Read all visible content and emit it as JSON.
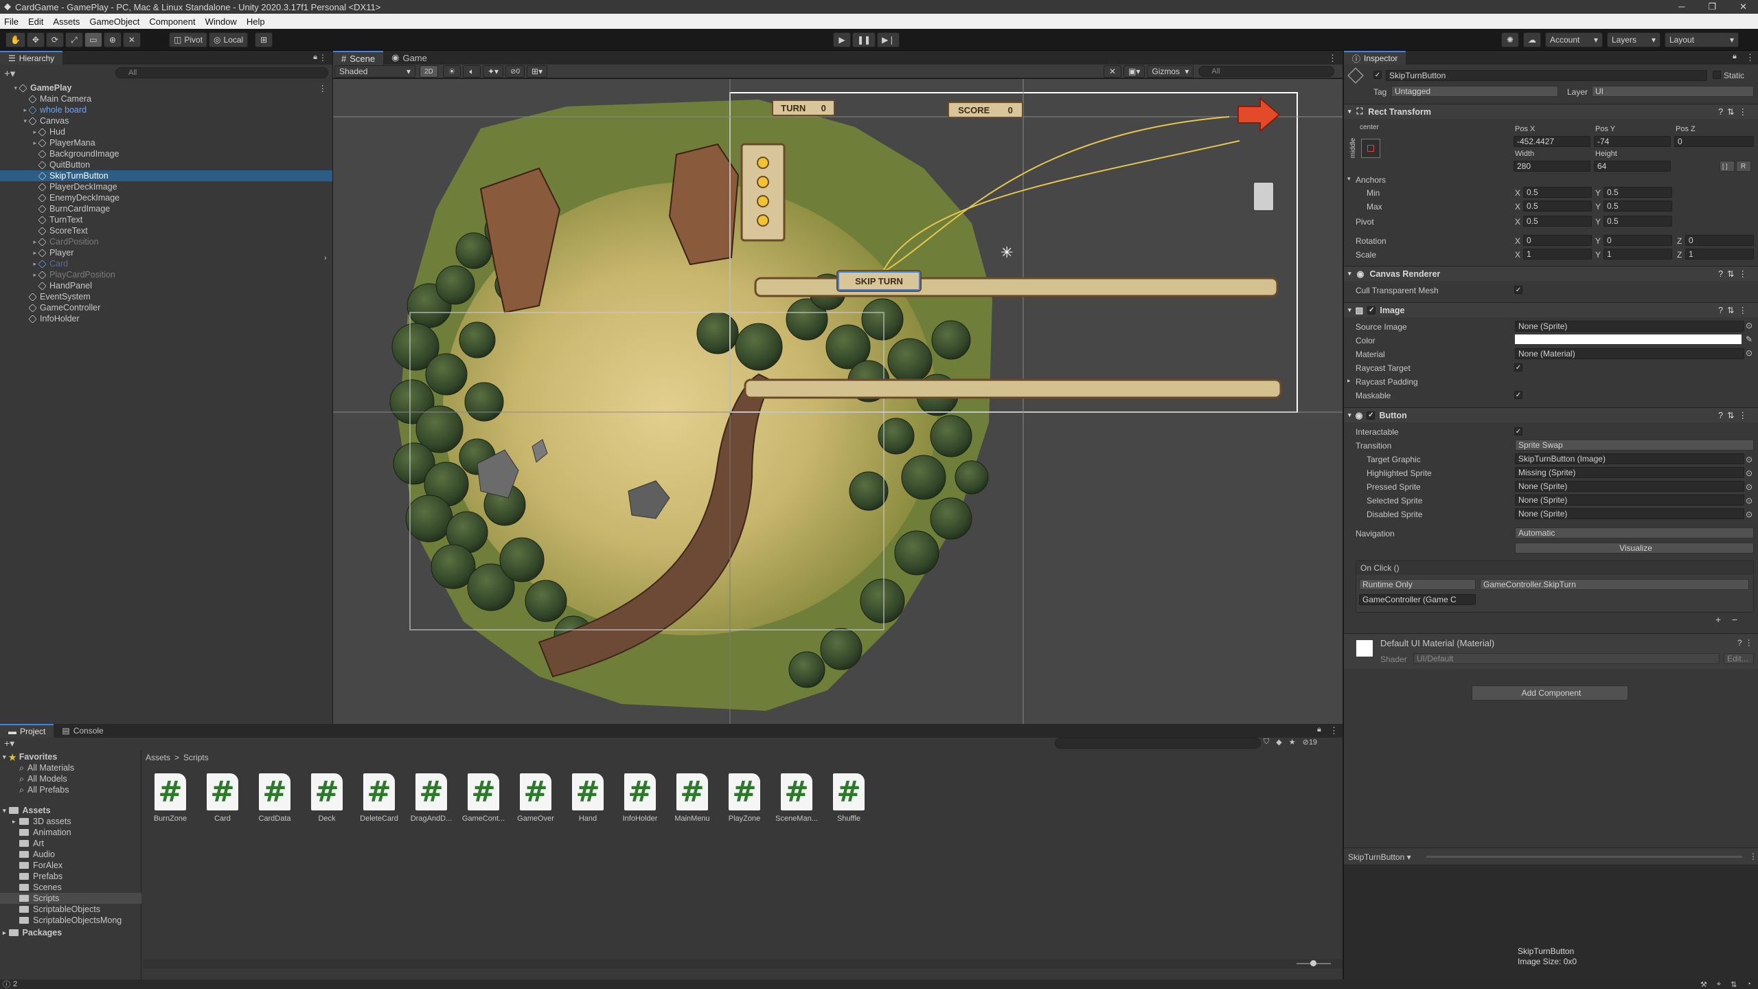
{
  "window": {
    "title": "CardGame - GamePlay - PC, Mac & Linux Standalone - Unity 2020.3.17f1 Personal <DX11>"
  },
  "menu": [
    "File",
    "Edit",
    "Assets",
    "GameObject",
    "Component",
    "Window",
    "Help"
  ],
  "toolbar": {
    "pivot": "Pivot",
    "local": "Local",
    "account": "Account",
    "layers": "Layers",
    "layout": "Layout"
  },
  "hierarchy": {
    "tab": "Hierarchy",
    "search": "All",
    "items": [
      {
        "label": "GamePlay",
        "indent": 0,
        "arrow": "▾",
        "kind": "scene"
      },
      {
        "label": "Main Camera",
        "indent": 1,
        "arrow": "",
        "kind": "go"
      },
      {
        "label": "whole board",
        "indent": 1,
        "arrow": "▸",
        "kind": "prefab"
      },
      {
        "label": "Canvas",
        "indent": 1,
        "arrow": "▾",
        "kind": "go"
      },
      {
        "label": "Hud",
        "indent": 2,
        "arrow": "▸",
        "kind": "go"
      },
      {
        "label": "PlayerMana",
        "indent": 2,
        "arrow": "▸",
        "kind": "go"
      },
      {
        "label": "BackgroundImage",
        "indent": 2,
        "arrow": "",
        "kind": "go"
      },
      {
        "label": "QuitButton",
        "indent": 2,
        "arrow": "",
        "kind": "go"
      },
      {
        "label": "SkipTurnButton",
        "indent": 2,
        "arrow": "",
        "kind": "go",
        "selected": true
      },
      {
        "label": "PlayerDeckImage",
        "indent": 2,
        "arrow": "",
        "kind": "go"
      },
      {
        "label": "EnemyDeckImage",
        "indent": 2,
        "arrow": "",
        "kind": "go"
      },
      {
        "label": "BurnCardImage",
        "indent": 2,
        "arrow": "",
        "kind": "go"
      },
      {
        "label": "TurnText",
        "indent": 2,
        "arrow": "",
        "kind": "go"
      },
      {
        "label": "ScoreText",
        "indent": 2,
        "arrow": "",
        "kind": "go"
      },
      {
        "label": "CardPosition",
        "indent": 2,
        "arrow": "▸",
        "kind": "go",
        "disabled": true
      },
      {
        "label": "Player",
        "indent": 2,
        "arrow": "▸",
        "kind": "go"
      },
      {
        "label": "Card",
        "indent": 2,
        "arrow": "▸",
        "kind": "prefab",
        "disabled": true
      },
      {
        "label": "PlayCardPosition",
        "indent": 2,
        "arrow": "▸",
        "kind": "go",
        "disabled": true
      },
      {
        "label": "HandPanel",
        "indent": 2,
        "arrow": "",
        "kind": "go"
      },
      {
        "label": "EventSystem",
        "indent": 1,
        "arrow": "",
        "kind": "go"
      },
      {
        "label": "GameController",
        "indent": 1,
        "arrow": "",
        "kind": "go"
      },
      {
        "label": "InfoHolder",
        "indent": 1,
        "arrow": "",
        "kind": "go"
      }
    ]
  },
  "scene": {
    "tab_scene": "Scene",
    "tab_game": "Game",
    "shading": "Shaded",
    "mode2d": "2D",
    "gizmos": "Gizmos",
    "search": "All",
    "layers_count": "0",
    "ui_turn": "TURN",
    "ui_turn_val": "0",
    "ui_score": "SCORE",
    "ui_score_val": "0",
    "ui_skip": "SKIP TURN"
  },
  "inspector": {
    "tab": "Inspector",
    "name": "SkipTurnButton",
    "static": "Static",
    "tag_label": "Tag",
    "tag": "Untagged",
    "layer_label": "Layer",
    "layer": "UI",
    "rect": {
      "title": "Rect Transform",
      "anchor_preset": "center",
      "side": "middle",
      "posx_l": "Pos X",
      "posy_l": "Pos Y",
      "posz_l": "Pos Z",
      "posx": "-452.4427",
      "posy": "-74",
      "posz": "0",
      "width_l": "Width",
      "height_l": "Height",
      "width": "280",
      "height": "64",
      "anchors": "Anchors",
      "min": "Min",
      "max": "Max",
      "pivot": "Pivot",
      "rotation": "Rotation",
      "scale": "Scale",
      "minx": "0.5",
      "miny": "0.5",
      "maxx": "0.5",
      "maxy": "0.5",
      "pivx": "0.5",
      "pivy": "0.5",
      "rotx": "0",
      "roty": "0",
      "rotz": "0",
      "scx": "1",
      "scy": "1",
      "scz": "1",
      "bl": "[ ]",
      "rl": "R"
    },
    "canvas_renderer": {
      "title": "Canvas Renderer",
      "cull": "Cull Transparent Mesh"
    },
    "image": {
      "title": "Image",
      "source_l": "Source Image",
      "source": "None (Sprite)",
      "color_l": "Color",
      "material_l": "Material",
      "material": "None (Material)",
      "raycast": "Raycast Target",
      "padding": "Raycast Padding",
      "maskable": "Maskable",
      "color": "#ffffff"
    },
    "button": {
      "title": "Button",
      "interactable": "Interactable",
      "transition_l": "Transition",
      "transition": "Sprite Swap",
      "target_l": "Target Graphic",
      "target": "SkipTurnButton (Image)",
      "highlighted_l": "Highlighted Sprite",
      "highlighted": "Missing (Sprite)",
      "pressed_l": "Pressed Sprite",
      "pressed": "None (Sprite)",
      "selected_l": "Selected Sprite",
      "selected": "None (Sprite)",
      "disabled_l": "Disabled Sprite",
      "disabled": "None (Sprite)",
      "navigation_l": "Navigation",
      "navigation": "Automatic",
      "visualize": "Visualize",
      "onclick": "On Click ()",
      "runtime": "Runtime Only",
      "function": "GameController.SkipTurn",
      "object": "GameController (Game C"
    },
    "material": {
      "title": "Default UI Material (Material)",
      "shader_l": "Shader",
      "shader": "UI/Default",
      "edit": "Edit..."
    },
    "add_component": "Add Component",
    "preview_name": "SkipTurnButton",
    "preview_title": "SkipTurnButton",
    "preview_size": "Image Size: 0x0"
  },
  "project": {
    "tab_project": "Project",
    "tab_console": "Console",
    "favorites": "Favorites",
    "fav_items": [
      "All Materials",
      "All Models",
      "All Prefabs"
    ],
    "assets": "Assets",
    "folders": [
      "3D assets",
      "Animation",
      "Art",
      "Audio",
      "ForAlex",
      "Prefabs",
      "Scenes",
      "Scripts",
      "ScriptableObjects",
      "ScriptableObjectsMong"
    ],
    "packages": "Packages",
    "crumb_root": "Assets",
    "crumb_sep": ">",
    "crumb_leaf": "Scripts",
    "count": "19",
    "scripts": [
      "BurnZone",
      "Card",
      "CardData",
      "Deck",
      "DeleteCard",
      "DragAndD...",
      "GameCont...",
      "GameOver",
      "Hand",
      "InfoHolder",
      "MainMenu",
      "PlayZone",
      "SceneMan...",
      "Shuffle"
    ]
  },
  "status": {
    "count": "2"
  },
  "colors": {
    "selection": "#2c5d87",
    "accent": "#3d86e6"
  }
}
